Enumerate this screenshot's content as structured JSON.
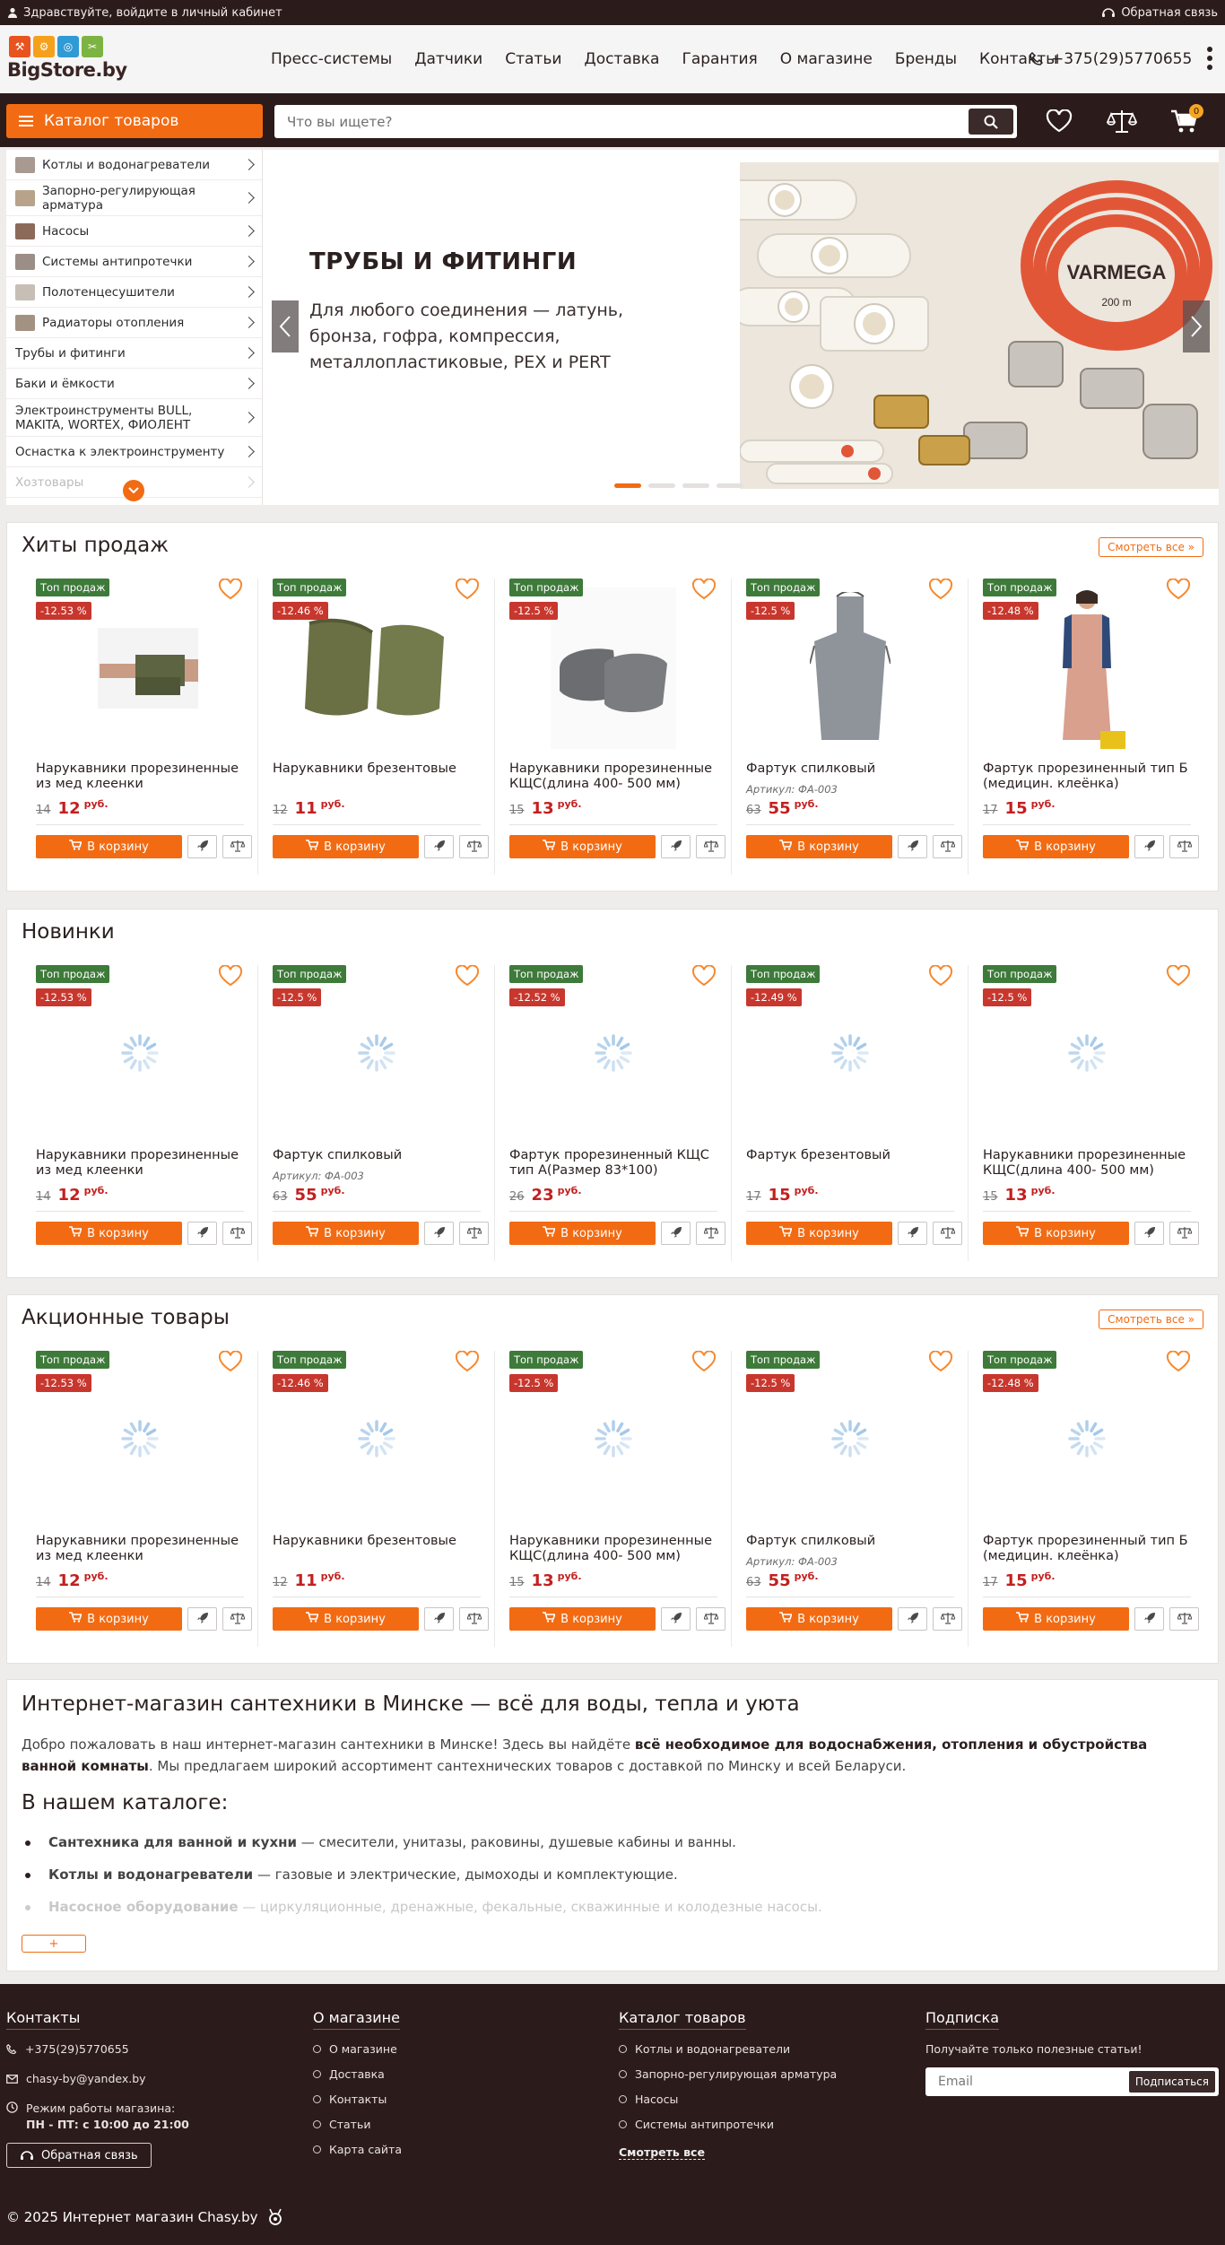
{
  "topbar": {
    "greeting": "Здравствуйте, войдите в личный кабинет",
    "callback": "Обратная связь"
  },
  "header": {
    "logo_text": "BigStore.by",
    "nav": [
      "Пресс-системы",
      "Датчики",
      "Статьи",
      "Доставка",
      "Гарантия",
      "О магазине",
      "Бренды",
      "Контакты"
    ],
    "phone": "+375(29)5770655"
  },
  "catbar": {
    "catalog_label": "Каталог товаров",
    "search_placeholder": "Что вы ищете?",
    "cart_count": "0"
  },
  "sidebar": {
    "items": [
      {
        "label": "Котлы и водонагреватели",
        "thumb": "#a89a90"
      },
      {
        "label": "Запорно-регулирующая арматура",
        "thumb": "#b7a38a"
      },
      {
        "label": "Насосы",
        "thumb": "#8c6a5a"
      },
      {
        "label": "Системы антипротечки",
        "thumb": "#9b8e86"
      },
      {
        "label": "Полотенцесушители",
        "thumb": "#c7bfb5"
      },
      {
        "label": "Радиаторы отопления",
        "thumb": "#a39282"
      },
      {
        "label": "Трубы и фитинги"
      },
      {
        "label": "Баки и ёмкости"
      },
      {
        "label": "Электроинструменты BULL, MAKITA, WORTEX, ФИОЛЕНТ"
      },
      {
        "label": "Оснастка к электроинструменту"
      },
      {
        "label": "Хозтовары"
      }
    ]
  },
  "slider": {
    "title": "ТРУБЫ И ФИТИНГИ",
    "text": "Для любого соединения — латунь, бронза, гофра, компрессия, металлопластиковые, PEX и PERT",
    "image_label": "VARMEGA",
    "image_sublabel": "200 m",
    "active_dot": 1,
    "dots": 4
  },
  "sections": [
    {
      "title": "Хиты продаж",
      "see_all": "Смотреть все »",
      "products": [
        {
          "badge": "Топ продаж",
          "discount": "-12.53 %",
          "name": "Нарукавники прорезиненные из мед клеенки",
          "sku": "",
          "old": "14",
          "price": "12",
          "img": "sleeves-person"
        },
        {
          "badge": "Топ продаж",
          "discount": "-12.46 %",
          "name": "Нарукавники брезентовые",
          "sku": "",
          "old": "12",
          "price": "11",
          "img": "sleeves-green"
        },
        {
          "badge": "Топ продаж",
          "discount": "-12.5 %",
          "name": "Нарукавники прорезиненные КЩС(длина 400- 500 мм)",
          "sku": "",
          "old": "15",
          "price": "13",
          "img": "sleeves-grey"
        },
        {
          "badge": "Топ продаж",
          "discount": "-12.5 %",
          "name": "Фартук спилковый",
          "sku": "Артикул: ФА-003",
          "old": "63",
          "price": "55",
          "img": "apron-grey"
        },
        {
          "badge": "Топ продаж",
          "discount": "-12.48 %",
          "name": "Фартук прорезиненный тип Б (медицин. клеёнка)",
          "sku": "",
          "old": "17",
          "price": "15",
          "img": "apron-person"
        }
      ]
    },
    {
      "title": "Новинки",
      "see_all": "",
      "products": [
        {
          "badge": "Топ продаж",
          "discount": "-12.53 %",
          "name": "Нарукавники прорезиненные из мед клеенки",
          "sku": "",
          "old": "14",
          "price": "12",
          "img": "loading"
        },
        {
          "badge": "Топ продаж",
          "discount": "-12.5 %",
          "name": "Фартук спилковый",
          "sku": "Артикул: ФА-003",
          "old": "63",
          "price": "55",
          "img": "loading"
        },
        {
          "badge": "Топ продаж",
          "discount": "-12.52 %",
          "name": "Фартук прорезиненный КЩС тип А(Размер 83*100)",
          "sku": "",
          "old": "26",
          "price": "23",
          "img": "loading"
        },
        {
          "badge": "Топ продаж",
          "discount": "-12.49 %",
          "name": "Фартук брезентовый",
          "sku": "",
          "old": "17",
          "price": "15",
          "img": "loading"
        },
        {
          "badge": "Топ продаж",
          "discount": "-12.5 %",
          "name": "Нарукавники прорезиненные КЩС(длина 400- 500 мм)",
          "sku": "",
          "old": "15",
          "price": "13",
          "img": "loading"
        }
      ]
    },
    {
      "title": "Акционные товары",
      "see_all": "Смотреть все »",
      "products": [
        {
          "badge": "Топ продаж",
          "discount": "-12.53 %",
          "name": "Нарукавники прорезиненные из мед клеенки",
          "sku": "",
          "old": "14",
          "price": "12",
          "img": "loading"
        },
        {
          "badge": "Топ продаж",
          "discount": "-12.46 %",
          "name": "Нарукавники брезентовые",
          "sku": "",
          "old": "12",
          "price": "11",
          "img": "loading"
        },
        {
          "badge": "Топ продаж",
          "discount": "-12.5 %",
          "name": "Нарукавники прорезиненные КЩС(длина 400- 500 мм)",
          "sku": "",
          "old": "15",
          "price": "13",
          "img": "loading"
        },
        {
          "badge": "Топ продаж",
          "discount": "-12.5 %",
          "name": "Фартук спилковый",
          "sku": "Артикул: ФА-003",
          "old": "63",
          "price": "55",
          "img": "loading"
        },
        {
          "badge": "Топ продаж",
          "discount": "-12.48 %",
          "name": "Фартук прорезиненный тип Б (медицин. клеёнка)",
          "sku": "",
          "old": "17",
          "price": "15",
          "img": "loading"
        }
      ]
    }
  ],
  "product_labels": {
    "currency": "руб.",
    "buy": "В корзину"
  },
  "seo": {
    "title": "Интернет-магазин сантехники в Минске — всё для воды, тепла и уюта",
    "intro_start": "Добро пожаловать в наш интернет-магазин сантехники в Минске! Здесь вы найдёте ",
    "intro_bold": "всё необходимое для водоснабжения, отопления и обустройства ванной комнаты",
    "intro_end": ". Мы предлагаем широкий ассортимент сантехнических товаров с доставкой по Минску и всей Беларуси.",
    "catalog_title": "В нашем каталоге:",
    "list": [
      {
        "bold": "Сантехника для ванной и кухни",
        "rest": " — смесители, унитазы, раковины, душевые кабины и ванны."
      },
      {
        "bold": "Котлы и водонагреватели",
        "rest": " — газовые и электрические, дымоходы и комплектующие."
      },
      {
        "bold": "Насосное оборудование",
        "rest": " — циркуляционные, дренажные, фекальные, скважинные и колодезные насосы."
      }
    ],
    "expand": "+"
  },
  "footer": {
    "contacts": {
      "title": "Контакты",
      "phone": "+375(29)5770655",
      "email": "chasy-by@yandex.by",
      "hours_label": "Режим работы магазина:",
      "hours": "ПН - ПТ: с 10:00 до 21:00",
      "callback": "Обратная связь"
    },
    "about": {
      "title": "О магазине",
      "links": [
        "О магазине",
        "Доставка",
        "Контакты",
        "Статьи",
        "Карта сайта"
      ]
    },
    "catalog": {
      "title": "Каталог товаров",
      "links": [
        "Котлы и водонагреватели",
        "Запорно-регулирующая арматура",
        "Насосы",
        "Системы антипротечки"
      ],
      "see_all": "Смотреть все"
    },
    "subscribe": {
      "title": "Подписка",
      "text": "Получайте только полезные статьи!",
      "placeholder": "Email",
      "button": "Подписаться"
    },
    "copyright": "© 2025 Интернет магазин Chasy.by"
  },
  "colors": {
    "accent": "#f26b13",
    "dark": "#2c1b1b",
    "badge_top": "#3e7a3a",
    "badge_discount": "#c8372d",
    "price": "#c41f1f"
  }
}
